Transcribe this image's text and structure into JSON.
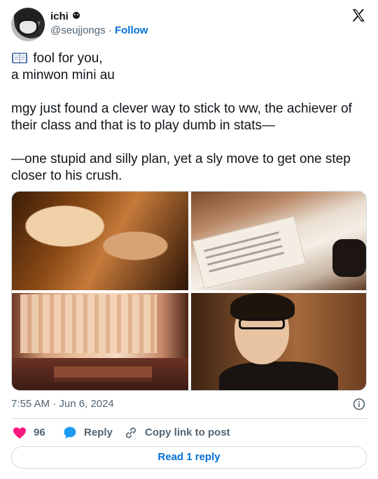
{
  "author": {
    "display_name": "ichi",
    "badge_icon": "smiley-icon",
    "handle": "@seujjongs",
    "separator": "·",
    "follow_label": "Follow"
  },
  "platform_icon": "x-logo-icon",
  "tweet": {
    "leading_icon": "book-icon",
    "text": "fool for you,\na minwon mini au\n\nmgy just found a clever way to stick to ww, the achiever of their class and that is to play dumb in stats—\n\n—one stupid and silly plan, yet a sly move to get one step closer to his crush."
  },
  "media": [
    {
      "description_icon": "photo-1"
    },
    {
      "description_icon": "photo-2"
    },
    {
      "description_icon": "photo-3"
    },
    {
      "description_icon": "photo-4"
    }
  ],
  "timestamp": "7:55 AM · Jun 6, 2024",
  "actions": {
    "likes": "96",
    "reply_label": "Reply",
    "copy_label": "Copy link to post"
  },
  "read_reply_label": "Read 1 reply",
  "colors": {
    "accent": "#006fd6",
    "like": "#f91880",
    "reply_icon": "#1d9bf0",
    "muted": "#536471",
    "border": "#cfd9de"
  }
}
